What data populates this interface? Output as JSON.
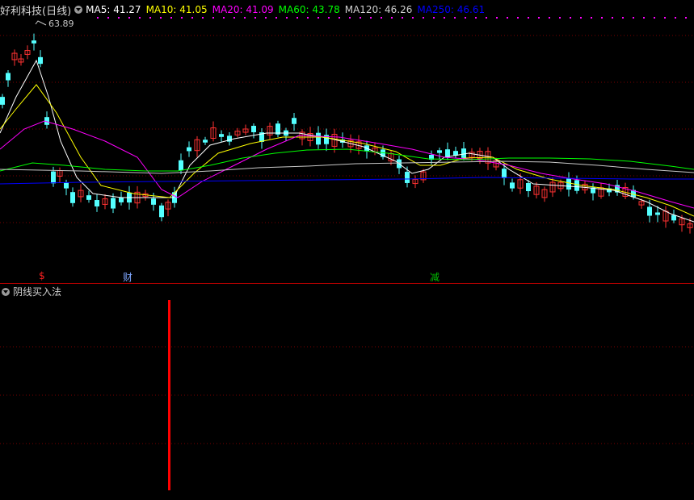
{
  "header": {
    "stock_name": "好利科技(日线)",
    "ma": [
      {
        "label": "MA5: 41.27",
        "color": "#ffffff"
      },
      {
        "label": "MA10: 41.05",
        "color": "#ffff00"
      },
      {
        "label": "MA20: 41.09",
        "color": "#ff00ff"
      },
      {
        "label": "MA60: 43.78",
        "color": "#00ff00"
      },
      {
        "label": "MA120: 46.26",
        "color": "#d0d0d0"
      },
      {
        "label": "MA250: 46.61",
        "color": "#0000ff"
      }
    ]
  },
  "chart": {
    "peak_label": "63.89",
    "markers": [
      {
        "text": "$",
        "color": "#ff2020"
      },
      {
        "text": "财",
        "color": "#7fa7ff"
      },
      {
        "text": "减",
        "color": "#00c000"
      }
    ]
  },
  "indicator": {
    "title": "阴线买入法",
    "color": "#ff0000"
  },
  "colors": {
    "up": "#ff3232",
    "down": "#54ffff",
    "grid": "#8b0000"
  }
}
